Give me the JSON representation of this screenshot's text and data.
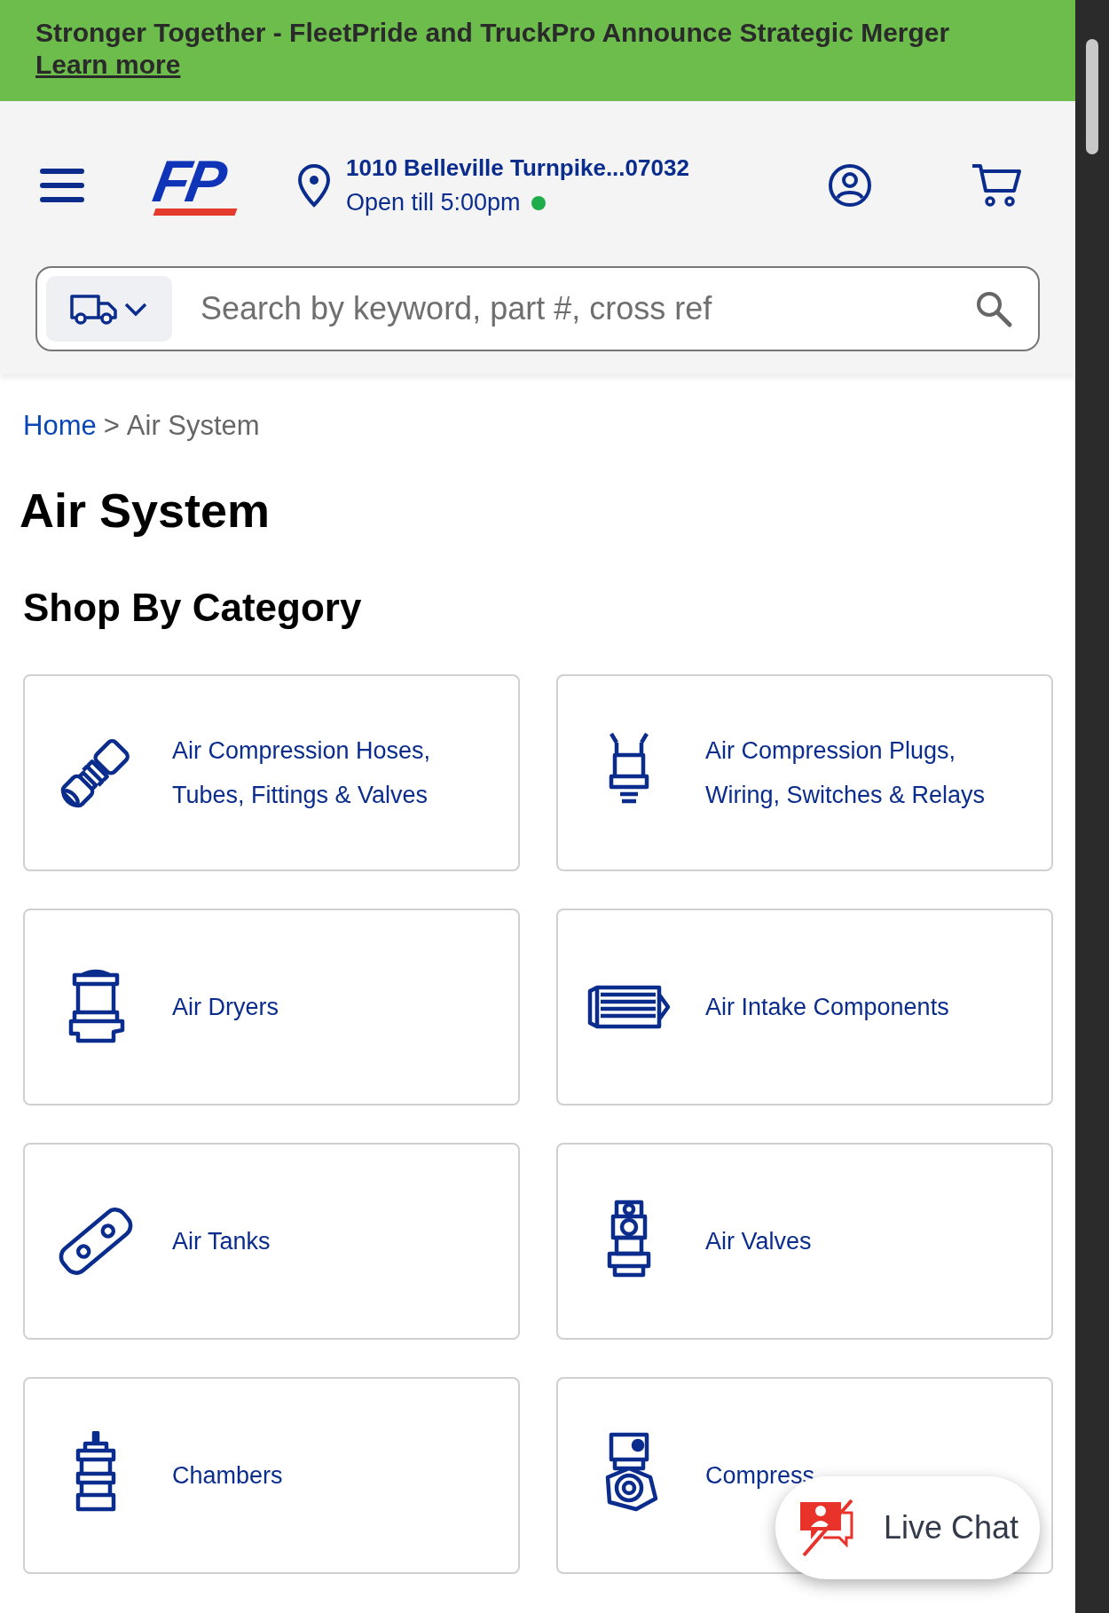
{
  "banner": {
    "text": "Stronger Together - FleetPride and TruckPro Announce Strategic Merger",
    "link": "Learn more"
  },
  "header": {
    "logo": "FP",
    "address": "1010 Belleville Turnpike...07032",
    "hours": "Open till 5:00pm"
  },
  "search": {
    "placeholder": "Search by keyword, part #, cross ref"
  },
  "breadcrumb": [
    {
      "label": "Home",
      "link": true
    },
    {
      "label": ">",
      "link": false
    },
    {
      "label": "Air System",
      "link": false
    }
  ],
  "title": "Air System",
  "section_title": "Shop By Category",
  "categories": [
    {
      "label": "Air Compression Hoses, Tubes, Fittings & Valves"
    },
    {
      "label": "Air Compression Plugs, Wiring, Switches & Relays"
    },
    {
      "label": "Air Dryers"
    },
    {
      "label": "Air Intake Components"
    },
    {
      "label": "Air Tanks"
    },
    {
      "label": "Air Valves"
    },
    {
      "label": "Chambers"
    },
    {
      "label": "Compress"
    }
  ],
  "live_chat": {
    "label": "Live Chat"
  }
}
